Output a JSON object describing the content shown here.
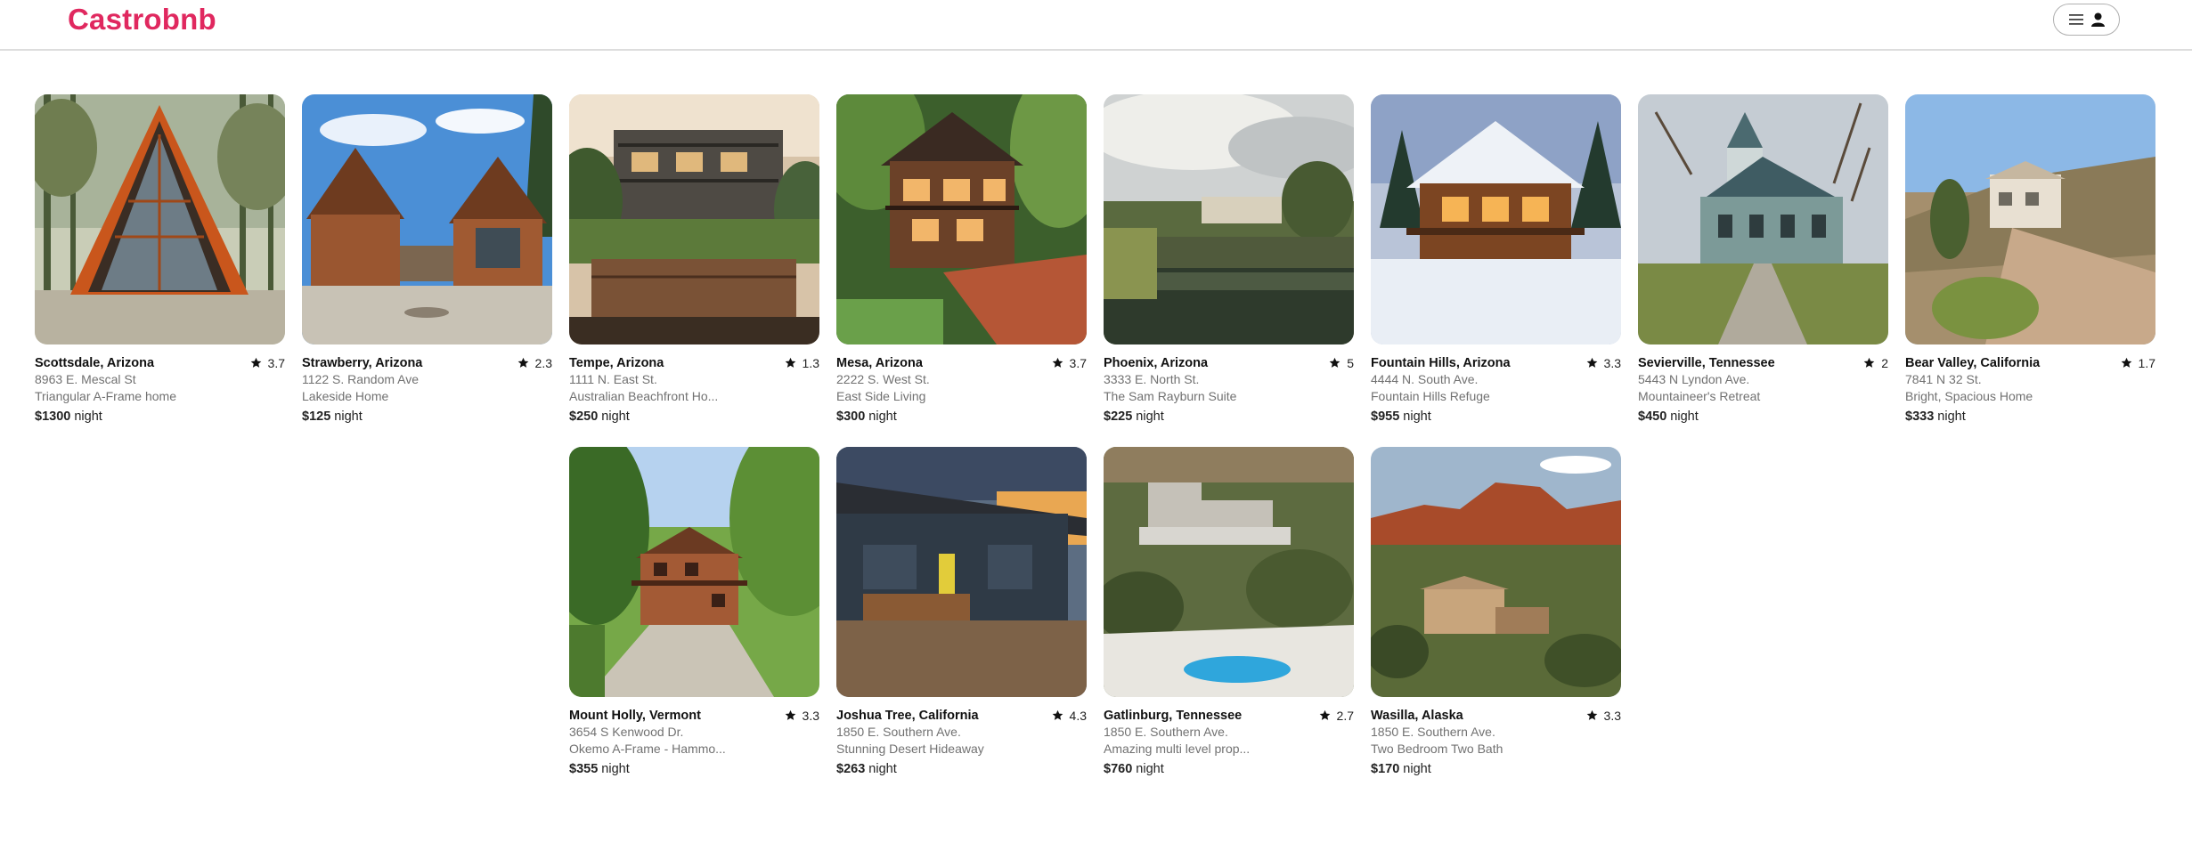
{
  "header": {
    "logo": "Castrobnb",
    "menu_icon": "hamburger-icon",
    "user_icon": "user-icon"
  },
  "colors": {
    "brand": "#e0285f",
    "muted": "#717171",
    "text": "#222222"
  },
  "unit_label": "night",
  "listings": [
    {
      "location": "Scottsdale, Arizona",
      "rating": "3.7",
      "address": "8963 E. Mescal St",
      "title": "Triangular A-Frame home",
      "price": "$1300",
      "scene": "a-frame"
    },
    {
      "location": "Strawberry, Arizona",
      "rating": "2.3",
      "address": "1122 S. Random Ave",
      "title": "Lakeside Home",
      "price": "$125",
      "scene": "twin-cabins"
    },
    {
      "location": "Tempe, Arizona",
      "rating": "1.3",
      "address": "1111 N. East St.",
      "title": "Australian Beachfront Ho...",
      "price": "$250",
      "scene": "deck-house"
    },
    {
      "location": "Mesa, Arizona",
      "rating": "3.7",
      "address": "2222 S. West St.",
      "title": "East Side Living",
      "price": "$300",
      "scene": "forest-cabin"
    },
    {
      "location": "Phoenix, Arizona",
      "rating": "5",
      "address": "3333 E. North St.",
      "title": "The Sam Rayburn Suite",
      "price": "$225",
      "scene": "pond-estate"
    },
    {
      "location": "Fountain Hills, Arizona",
      "rating": "3.3",
      "address": "4444 N. South Ave.",
      "title": "Fountain Hills Refuge",
      "price": "$955",
      "scene": "snow-chalet"
    },
    {
      "location": "Sevierville, Tennessee",
      "rating": "2",
      "address": "5443 N Lyndon Ave.",
      "title": "Mountaineer's Retreat",
      "price": "$450",
      "scene": "victorian"
    },
    {
      "location": "Bear Valley, California",
      "rating": "1.7",
      "address": "7841 N 32 St.",
      "title": "Bright, Spacious Home",
      "price": "$333",
      "scene": "desert-villa"
    },
    {
      "location": "Mount Holly, Vermont",
      "rating": "3.3",
      "address": "3654 S Kenwood Dr.",
      "title": "Okemo A-Frame - Hammo...",
      "price": "$355",
      "scene": "woods-lodge"
    },
    {
      "location": "Joshua Tree, California",
      "rating": "4.3",
      "address": "1850 E. Southern Ave.",
      "title": "Stunning Desert Hideaway",
      "price": "$263",
      "scene": "modern-cabin"
    },
    {
      "location": "Gatlinburg, Tennessee",
      "rating": "2.7",
      "address": "1850 E. Southern Ave.",
      "title": "Amazing multi level prop...",
      "price": "$760",
      "scene": "hillside-pool"
    },
    {
      "location": "Wasilla, Alaska",
      "rating": "3.3",
      "address": "1850 E. Southern Ave.",
      "title": "Two Bedroom Two Bath",
      "price": "$170",
      "scene": "red-rock"
    }
  ]
}
